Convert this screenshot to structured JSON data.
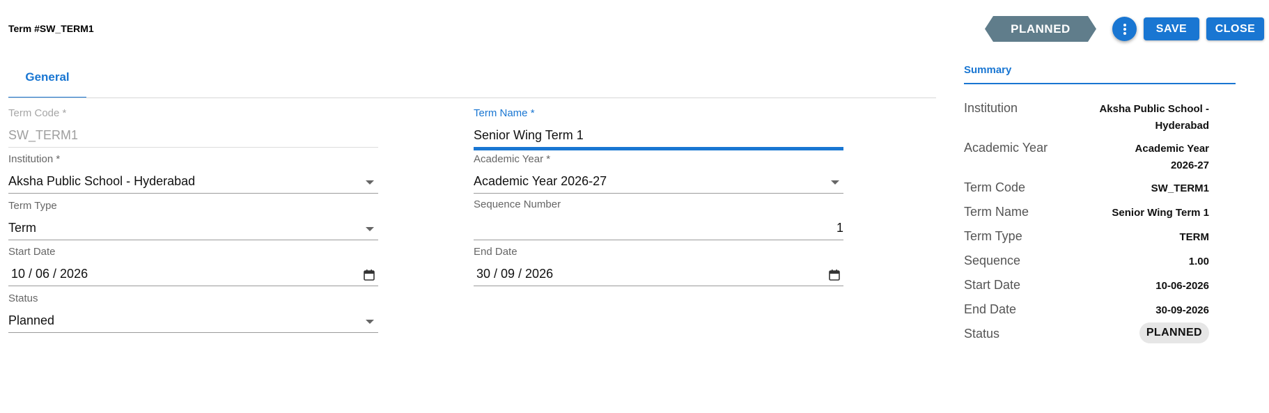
{
  "header": {
    "title": "Term #SW_TERM1",
    "status_ribbon": "PLANNED",
    "more_icon": "more-vert-icon",
    "save_label": "SAVE",
    "close_label": "CLOSE"
  },
  "tabs": [
    {
      "label": "General",
      "active": true
    }
  ],
  "form": {
    "term_code": {
      "label": "Term Code",
      "required_mark": "*",
      "value": "SW_TERM1"
    },
    "term_name": {
      "label": "Term Name",
      "required_mark": "*",
      "value": "Senior Wing Term 1"
    },
    "institution": {
      "label": "Institution",
      "required_mark": "*",
      "value": "Aksha Public School - Hyderabad"
    },
    "academic_year": {
      "label": "Academic Year",
      "required_mark": "*",
      "value": "Academic Year 2026-27"
    },
    "term_type": {
      "label": "Term Type",
      "value": "Term"
    },
    "sequence_number": {
      "label": "Sequence Number",
      "value": "1"
    },
    "start_date": {
      "label": "Start Date",
      "value": "10 / 06 / 2026"
    },
    "end_date": {
      "label": "End Date",
      "value": "30 / 09 / 2026"
    },
    "status": {
      "label": "Status",
      "value": "Planned"
    }
  },
  "summary": {
    "heading": "Summary",
    "rows": [
      {
        "key": "Institution",
        "value": "Aksha Public School - Hyderabad"
      },
      {
        "key": "Academic Year",
        "value": "Academic Year 2026-27"
      },
      {
        "key": "Term Code",
        "value": "SW_TERM1"
      },
      {
        "key": "Term Name",
        "value": "Senior Wing Term 1"
      },
      {
        "key": "Term Type",
        "value": "TERM"
      },
      {
        "key": "Sequence",
        "value": "1.00"
      },
      {
        "key": "Start Date",
        "value": "10-06-2026"
      },
      {
        "key": "End Date",
        "value": "30-09-2026"
      },
      {
        "key": "Status",
        "value": "PLANNED"
      }
    ]
  },
  "colors": {
    "primary": "#1976d2",
    "ribbon": "#607d8b",
    "chip_bg": "#e6e6e6"
  }
}
